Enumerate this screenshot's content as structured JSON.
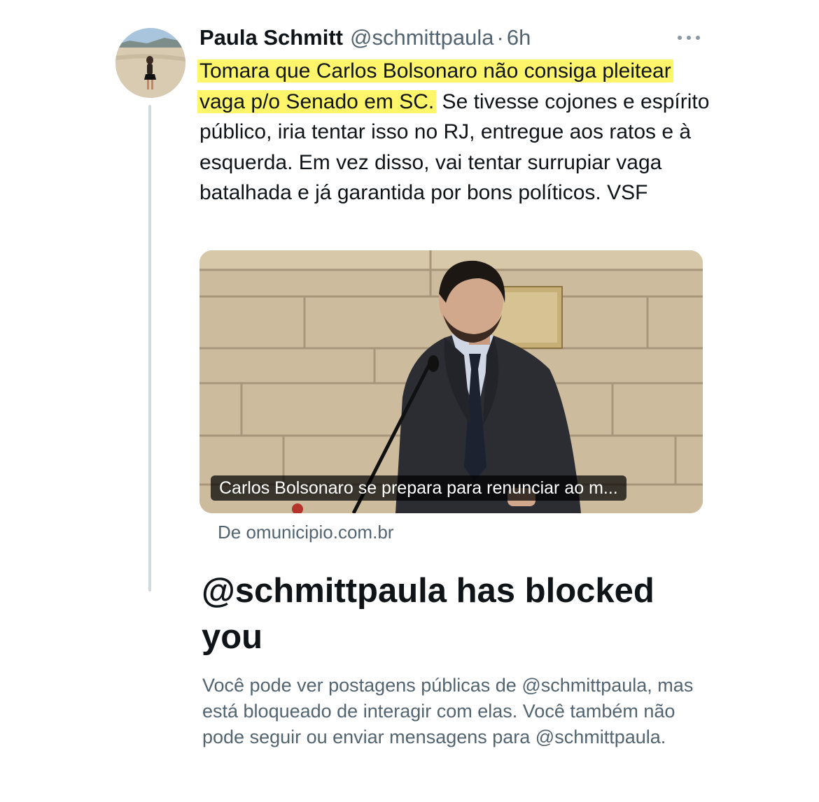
{
  "tweet": {
    "author": {
      "display_name": "Paula Schmitt",
      "handle": "@schmittpaula",
      "separator": "·",
      "time": "6h",
      "avatar_icon": "profile-photo-beach"
    },
    "more_icon": "ellipsis-horizontal-icon",
    "text_highlighted": "Tomara que Carlos Bolsonaro não consiga pleitear vaga p/o Senado em SC.",
    "text_rest": " Se tivesse cojones e espírito público, iria tentar isso no RJ, entregue aos ratos e à esquerda. Em vez disso, vai tentar surrupiar vaga batalhada e já garantida por bons políticos. VSF",
    "highlight_color": "#fff56a",
    "link_card": {
      "image_icon": "man-at-podium-photo",
      "caption": "Carlos Bolsonaro se prepara para renunciar ao m...",
      "source": "De omunicipio.com.br"
    }
  },
  "blocked_notice": {
    "title": "@schmittpaula has blocked you",
    "body": "Você pode ver postagens públicas de @schmittpaula, mas está bloqueado de interagir com elas. Você também não pode seguir ou enviar mensagens para @schmittpaula."
  },
  "colors": {
    "text_primary": "#0f1419",
    "text_secondary": "#536471",
    "thread_line": "#cfd9de"
  }
}
